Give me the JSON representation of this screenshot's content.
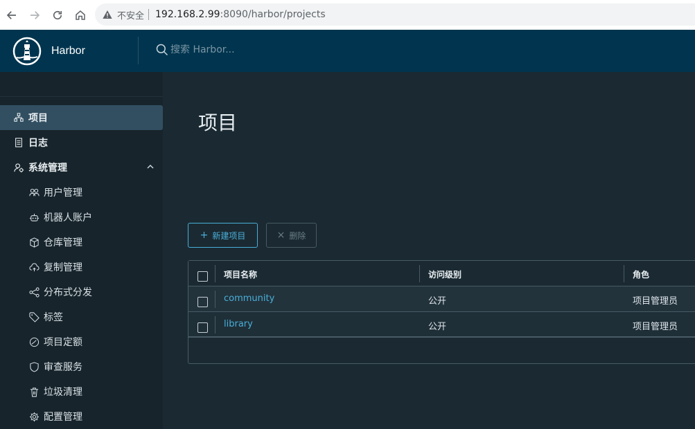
{
  "browser": {
    "insecure_label": "不安全",
    "url_host": "192.168.2.99",
    "url_rest": ":8090/harbor/projects"
  },
  "header": {
    "brand": "Harbor",
    "search_placeholder": "搜索 Harbor..."
  },
  "sidebar": {
    "items": [
      {
        "label": "项目",
        "icon": "project-icon",
        "active": true
      },
      {
        "label": "日志",
        "icon": "log-icon"
      },
      {
        "label": "系统管理",
        "icon": "admin-icon",
        "expanded": true
      }
    ],
    "sub_items": [
      {
        "label": "用户管理",
        "icon": "users-icon"
      },
      {
        "label": "机器人账户",
        "icon": "robot-icon"
      },
      {
        "label": "仓库管理",
        "icon": "registry-icon"
      },
      {
        "label": "复制管理",
        "icon": "cloud-sync-icon"
      },
      {
        "label": "分布式分发",
        "icon": "share-icon"
      },
      {
        "label": "标签",
        "icon": "tag-icon"
      },
      {
        "label": "项目定额",
        "icon": "gauge-icon"
      },
      {
        "label": "审查服务",
        "icon": "shield-icon"
      },
      {
        "label": "垃圾清理",
        "icon": "trash-icon"
      },
      {
        "label": "配置管理",
        "icon": "gear-icon"
      }
    ]
  },
  "main": {
    "title": "项目",
    "new_button": "新建项目",
    "delete_button": "删除",
    "columns": [
      "项目名称",
      "访问级别",
      "角色"
    ],
    "rows": [
      {
        "name": "community",
        "access": "公开",
        "role": "项目管理员"
      },
      {
        "name": "library",
        "access": "公开",
        "role": "项目管理员"
      }
    ]
  },
  "colors": {
    "header_bg": "#01354f",
    "sidebar_bg": "#17242b",
    "active_item_bg": "#324f61",
    "accent": "#49afd9"
  }
}
